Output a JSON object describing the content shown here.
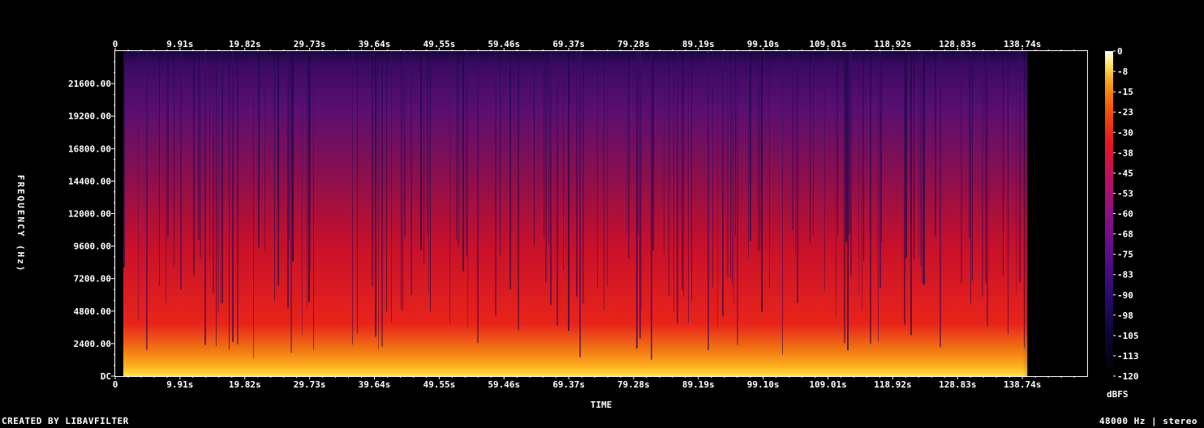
{
  "chart_data": {
    "type": "heatmap",
    "title": "",
    "xlabel": "TIME",
    "ylabel": "FREQUENCY (Hz)",
    "x_ticks": [
      "0",
      "9.91s",
      "19.82s",
      "29.73s",
      "39.64s",
      "49.55s",
      "59.46s",
      "69.37s",
      "79.28s",
      "89.19s",
      "99.10s",
      "109.01s",
      "118.92s",
      "128.83s",
      "138.74s"
    ],
    "x_tick_values": [
      0,
      9.91,
      19.82,
      29.73,
      39.64,
      49.55,
      59.46,
      69.37,
      79.28,
      89.19,
      99.1,
      109.01,
      118.92,
      128.83,
      138.74
    ],
    "xlim": [
      0,
      148.65
    ],
    "audio_end_s": 139.5,
    "y_ticks": [
      "DC",
      "2400.00",
      "4800.00",
      "7200.00",
      "9600.00",
      "12000.00",
      "14400.00",
      "16800.00",
      "19200.00",
      "21600.00"
    ],
    "y_tick_values": [
      0,
      2400,
      4800,
      7200,
      9600,
      12000,
      14400,
      16800,
      19200,
      21600
    ],
    "ylim": [
      0,
      24000
    ],
    "colorbar": {
      "label": "dBFS",
      "ticks": [
        "0",
        "-8",
        "-15",
        "-23",
        "-30",
        "-38",
        "-45",
        "-53",
        "-60",
        "-68",
        "-75",
        "-83",
        "-90",
        "-98",
        "-105",
        "-113",
        "-120"
      ],
      "range": [
        -120,
        0
      ]
    },
    "grid": false,
    "legend": "colorbar-right"
  },
  "footer": {
    "left": "CREATED BY LIBAVFILTER",
    "right": "48000 Hz | stereo"
  }
}
